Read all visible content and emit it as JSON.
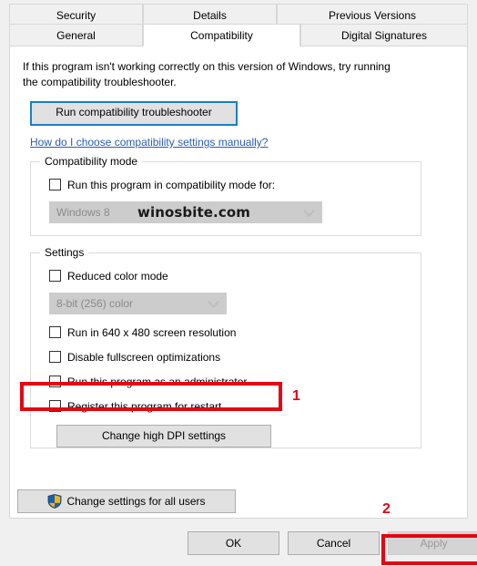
{
  "tabs": {
    "row1": [
      {
        "label": "Security",
        "selected": false
      },
      {
        "label": "Details",
        "selected": false
      },
      {
        "label": "Previous Versions",
        "selected": false
      }
    ],
    "row2": [
      {
        "label": "General",
        "selected": false
      },
      {
        "label": "Compatibility",
        "selected": true
      },
      {
        "label": "Digital Signatures",
        "selected": false
      }
    ]
  },
  "content": {
    "intro": "If this program isn't working correctly on this version of Windows, try running the compatibility troubleshooter.",
    "troubleshooter_button": "Run compatibility troubleshooter",
    "help_link": "How do I choose compatibility settings manually?"
  },
  "compatibility_mode": {
    "legend": "Compatibility mode",
    "checkbox_label": "Run this program in compatibility mode for:",
    "checkbox_checked": false,
    "combo_value": "Windows 8",
    "combo_disabled": true,
    "watermark": "winosbite.com"
  },
  "settings": {
    "legend": "Settings",
    "reduced_color_label": "Reduced color mode",
    "reduced_color_checked": false,
    "color_depth_value": "8-bit (256) color",
    "color_depth_disabled": true,
    "checkboxes": [
      {
        "label": "Run in 640 x 480 screen resolution",
        "checked": false
      },
      {
        "label": "Disable fullscreen optimizations",
        "checked": false
      },
      {
        "label": "Run this program as an administrator",
        "checked": false
      },
      {
        "label": "Register this program for restart",
        "checked": false
      }
    ],
    "dpi_button": "Change high DPI settings"
  },
  "all_users_button": "Change settings for all users",
  "buttons": {
    "ok": "OK",
    "cancel": "Cancel",
    "apply": "Apply",
    "apply_disabled": true
  },
  "annotations": [
    {
      "number": "1",
      "target": "Run this program as an administrator"
    },
    {
      "number": "2",
      "target": "Apply"
    }
  ],
  "colors": {
    "annotation_red": "#e30613",
    "link_blue": "#2a5db0",
    "focus_blue": "#1a7fc1"
  }
}
